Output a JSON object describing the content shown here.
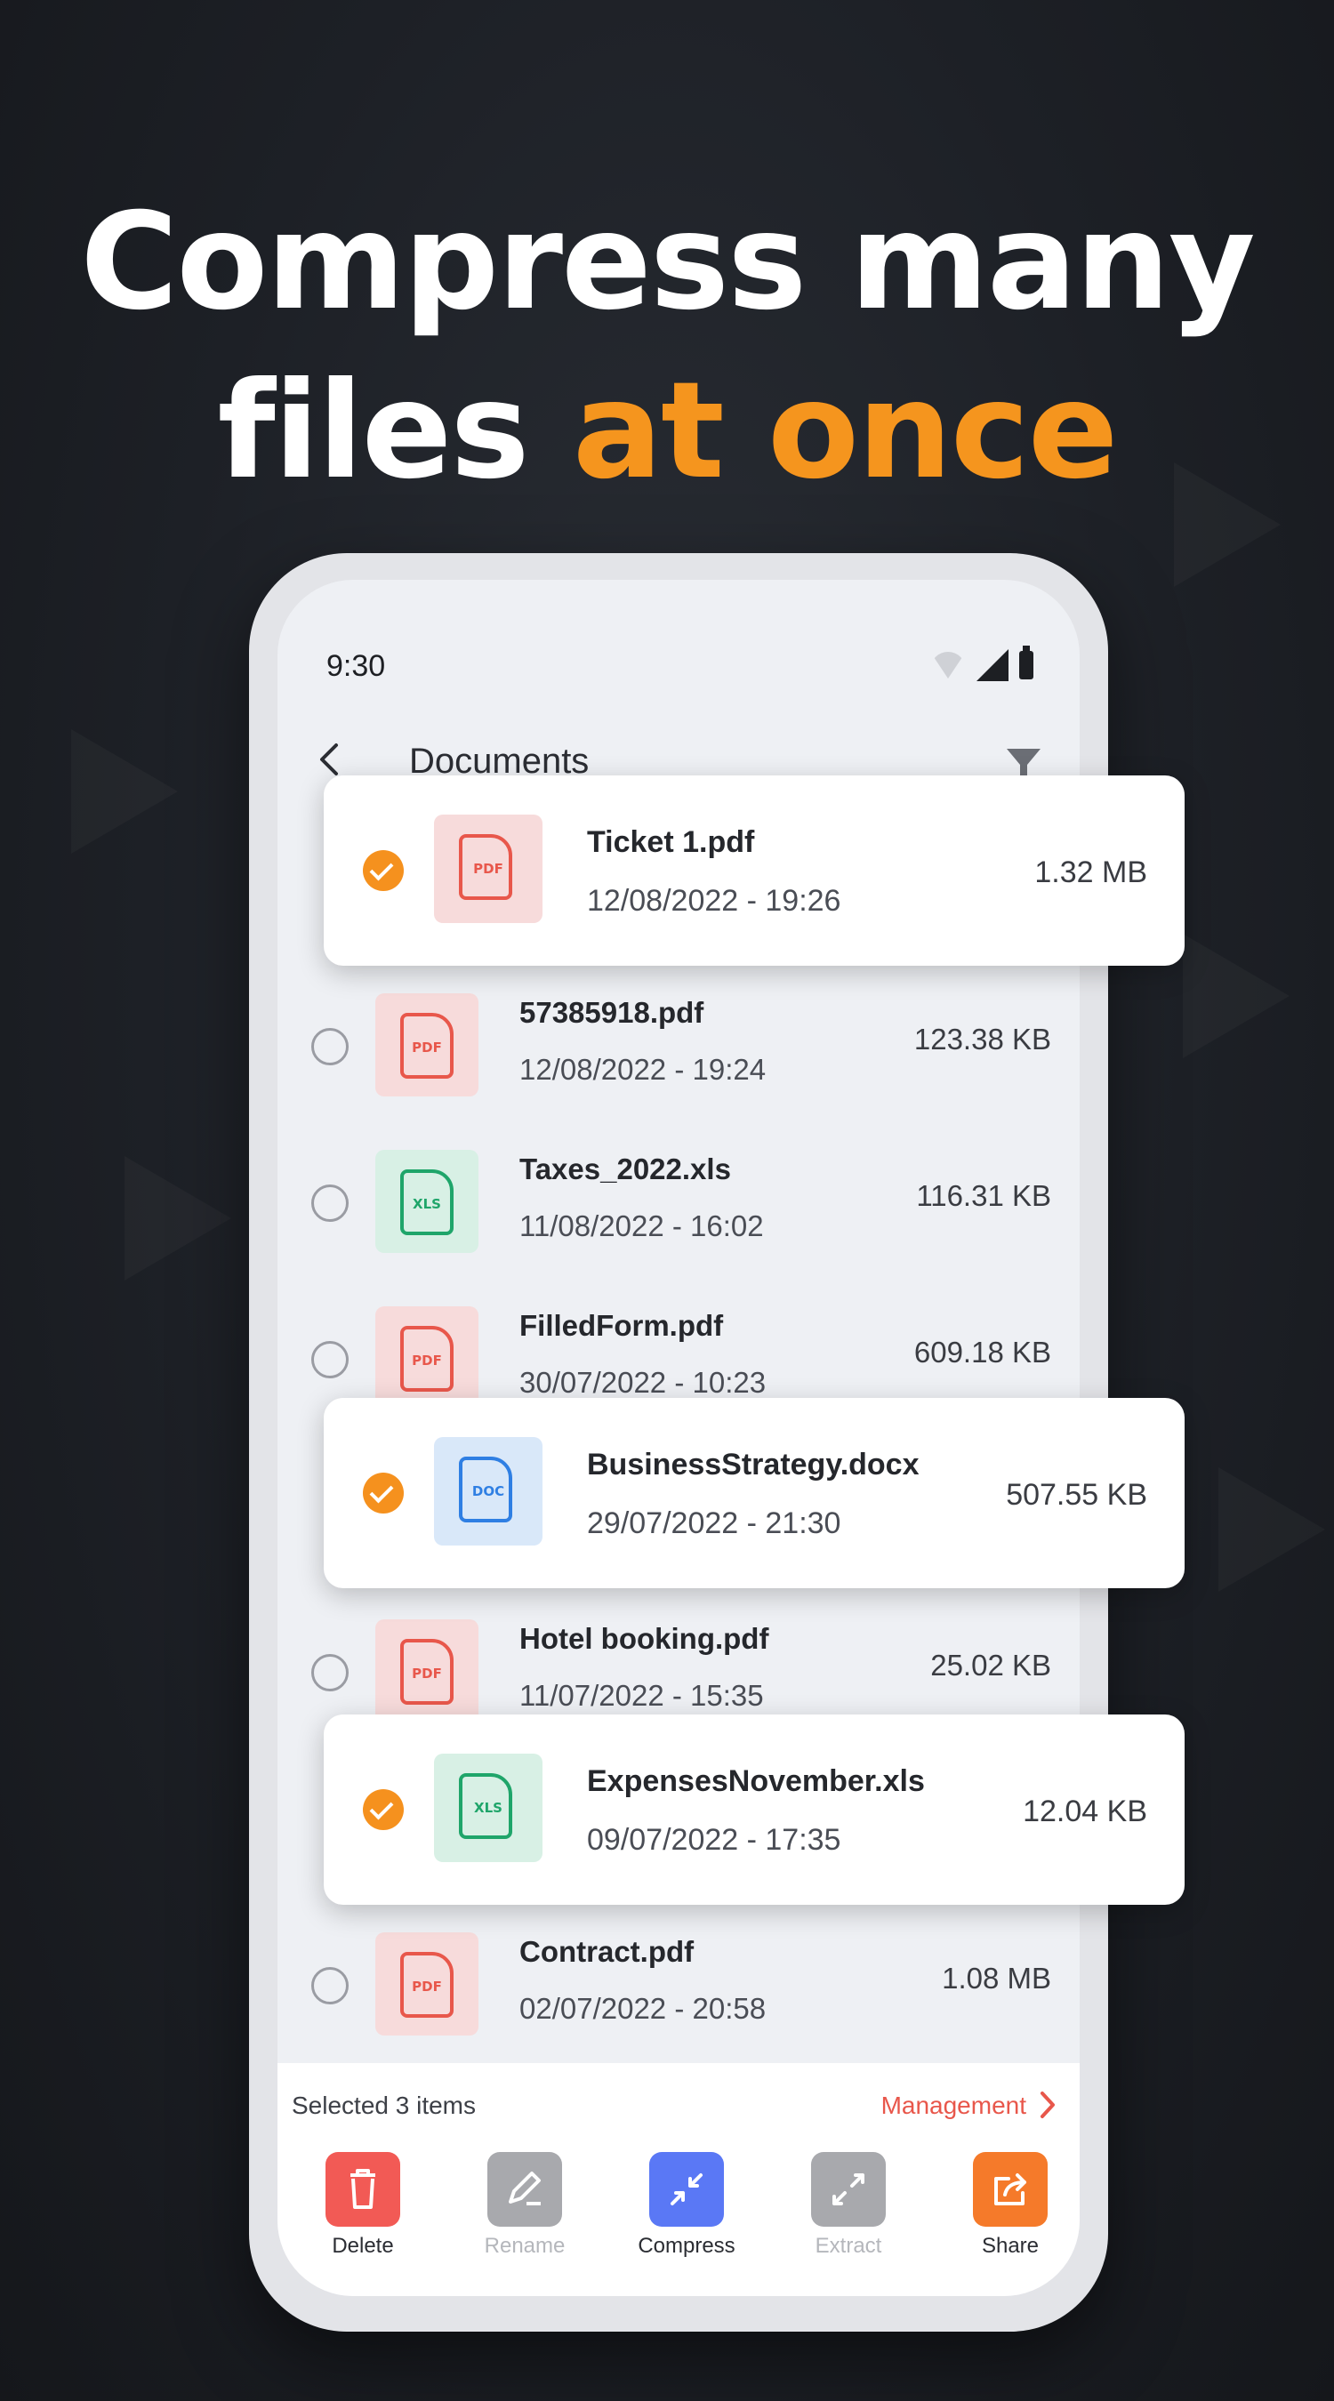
{
  "headline": {
    "line1": "Compress many",
    "line2_plain": "files ",
    "line2_accent": "at once"
  },
  "status_bar": {
    "time": "9:30"
  },
  "app_bar": {
    "title": "Documents"
  },
  "files": [
    {
      "name": "Ticket 1.pdf",
      "date": "12/08/2022 - 19:26",
      "size": "1.32 MB",
      "type": "PDF",
      "selected": true
    },
    {
      "name": "57385918.pdf",
      "date": "12/08/2022 - 19:24",
      "size": "123.38 KB",
      "type": "PDF",
      "selected": false
    },
    {
      "name": "Taxes_2022.xls",
      "date": "11/08/2022 - 16:02",
      "size": "116.31 KB",
      "type": "XLS",
      "selected": false
    },
    {
      "name": "FilledForm.pdf",
      "date": "30/07/2022 - 10:23",
      "size": "609.18 KB",
      "type": "PDF",
      "selected": false
    },
    {
      "name": "BusinessStrategy.docx",
      "date": "29/07/2022 - 21:30",
      "size": "507.55 KB",
      "type": "DOC",
      "selected": true
    },
    {
      "name": "Hotel booking.pdf",
      "date": "11/07/2022 - 15:35",
      "size": "25.02 KB",
      "type": "PDF",
      "selected": false
    },
    {
      "name": "ExpensesNovember.xls",
      "date": "09/07/2022 - 17:35",
      "size": "12.04 KB",
      "type": "XLS",
      "selected": true
    },
    {
      "name": "Contract.pdf",
      "date": "02/07/2022 - 20:58",
      "size": "1.08 MB",
      "type": "PDF",
      "selected": false
    }
  ],
  "selection_bar": {
    "selected_text": "Selected 3 items",
    "management_label": "Management"
  },
  "actions": [
    {
      "label": "Delete",
      "enabled": true
    },
    {
      "label": "Rename",
      "enabled": false
    },
    {
      "label": "Compress",
      "enabled": true
    },
    {
      "label": "Extract",
      "enabled": false
    },
    {
      "label": "Share",
      "enabled": true
    }
  ],
  "colors": {
    "accent": "#f5951e",
    "pdf": "#e8574b",
    "xls": "#1fa56a",
    "doc": "#2f7fe3"
  }
}
